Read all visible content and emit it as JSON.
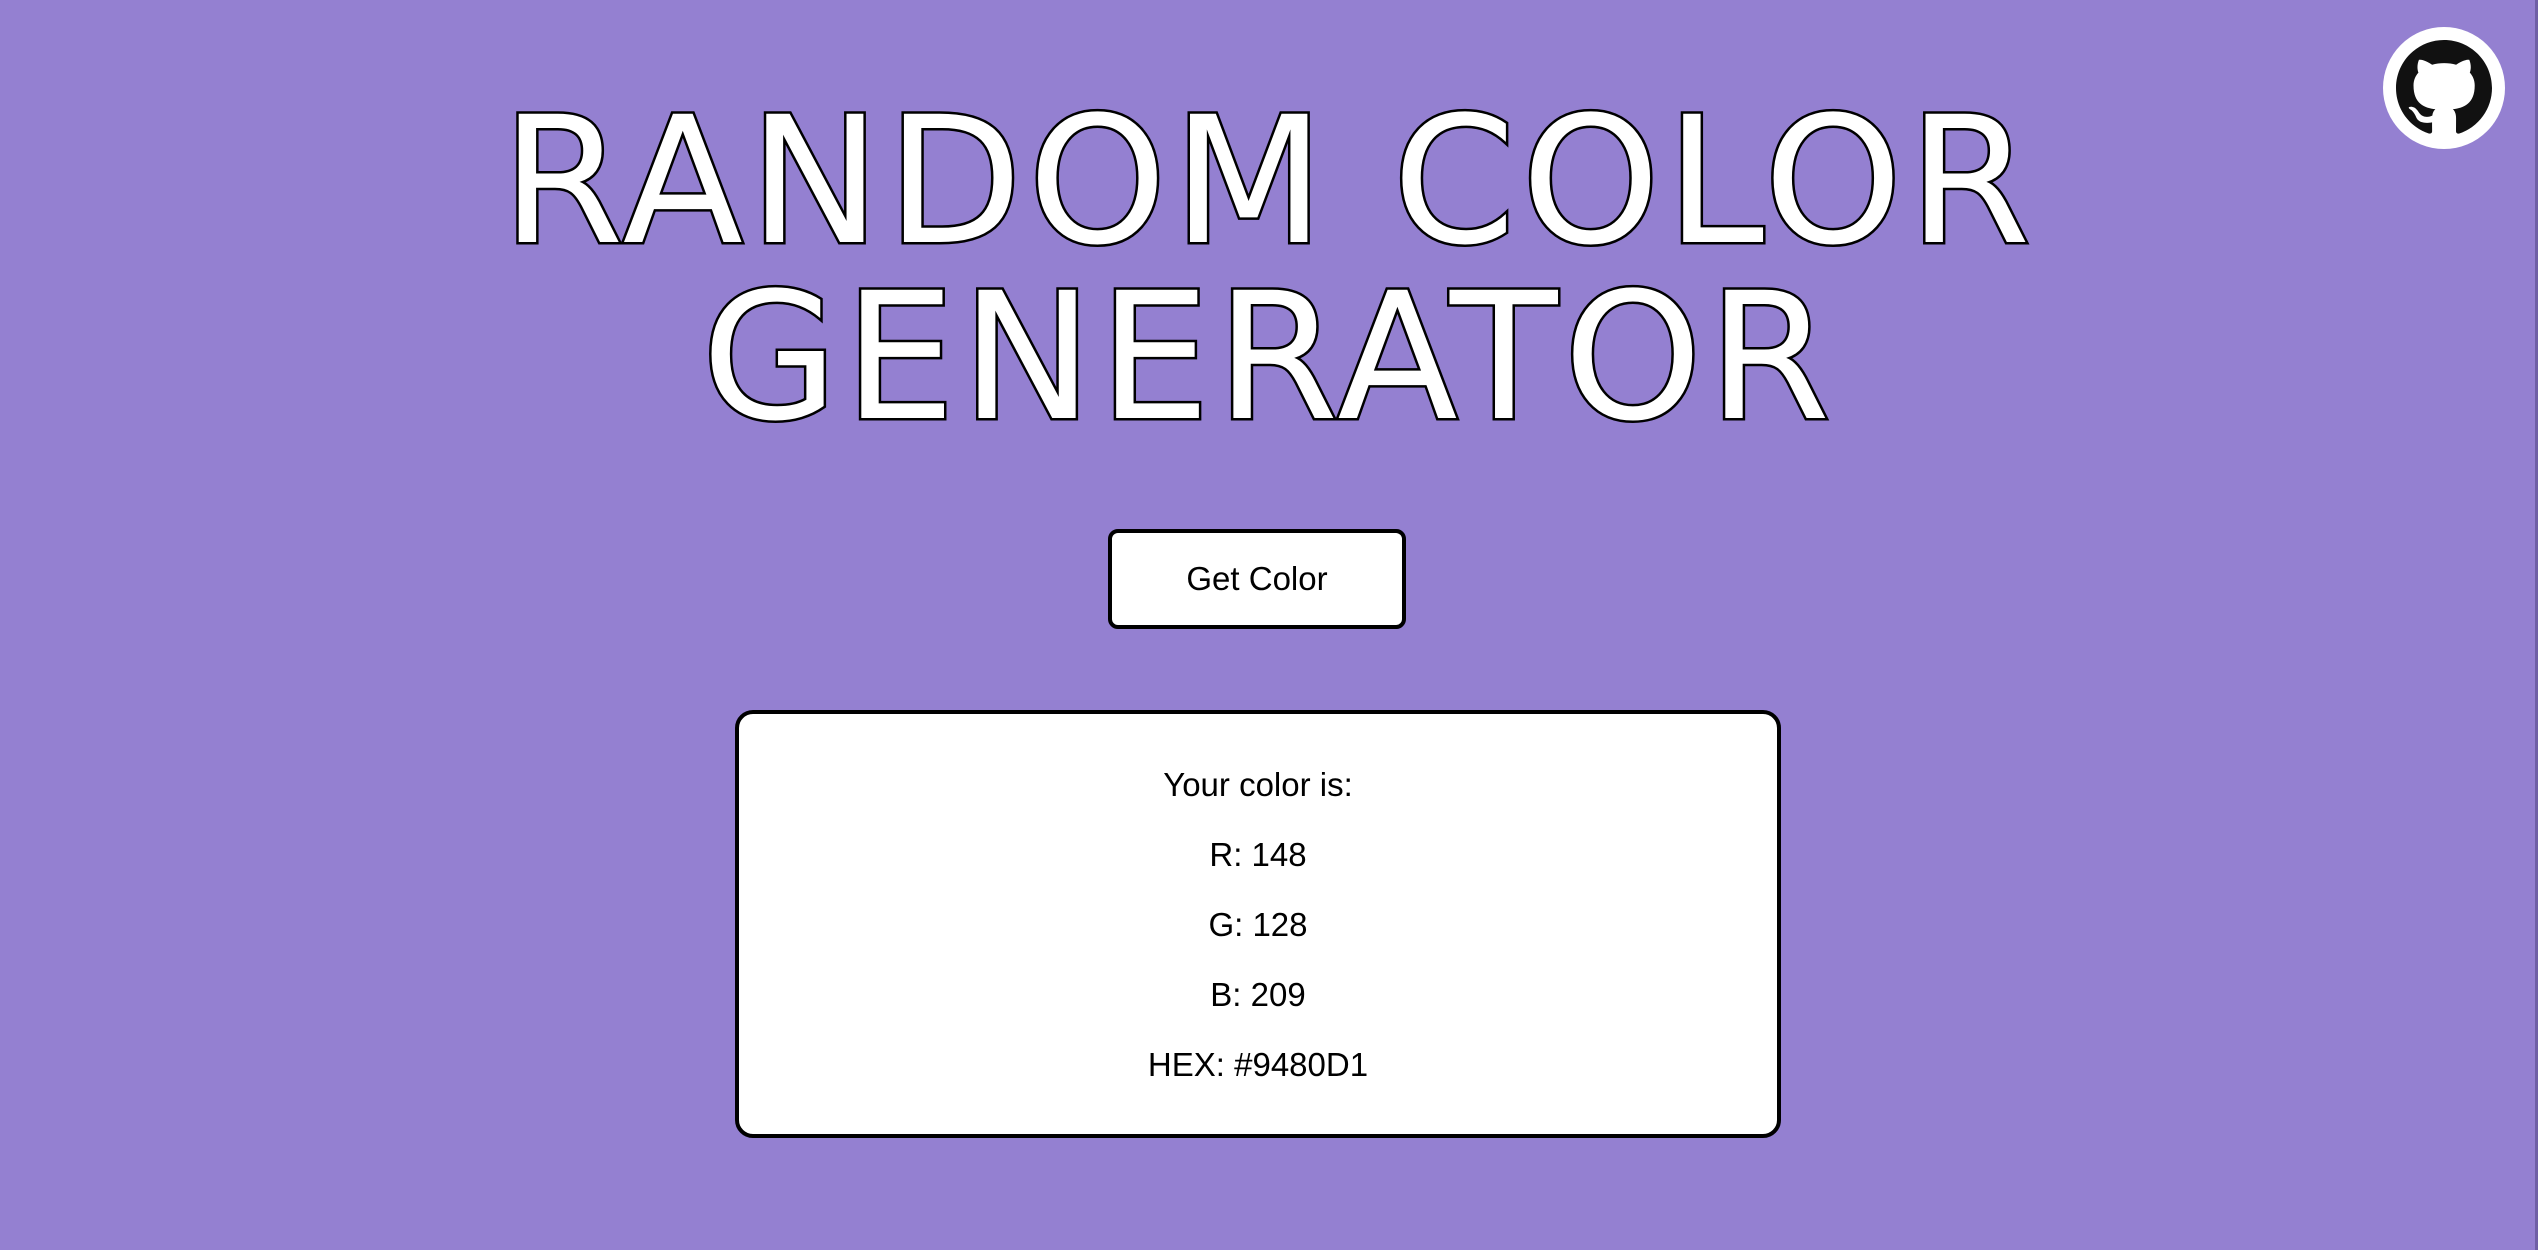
{
  "page": {
    "background_color": "#9480D1"
  },
  "header": {
    "title_line_1": "RANDOM COLOR",
    "title_line_2": "GENERATOR"
  },
  "github": {
    "icon": "github-icon"
  },
  "controls": {
    "get_color_label": "Get Color"
  },
  "result": {
    "heading": "Your color is:",
    "r_text": "R: 148",
    "g_text": "G: 128",
    "b_text": "B: 209",
    "hex_text": "HEX: #9480D1"
  }
}
